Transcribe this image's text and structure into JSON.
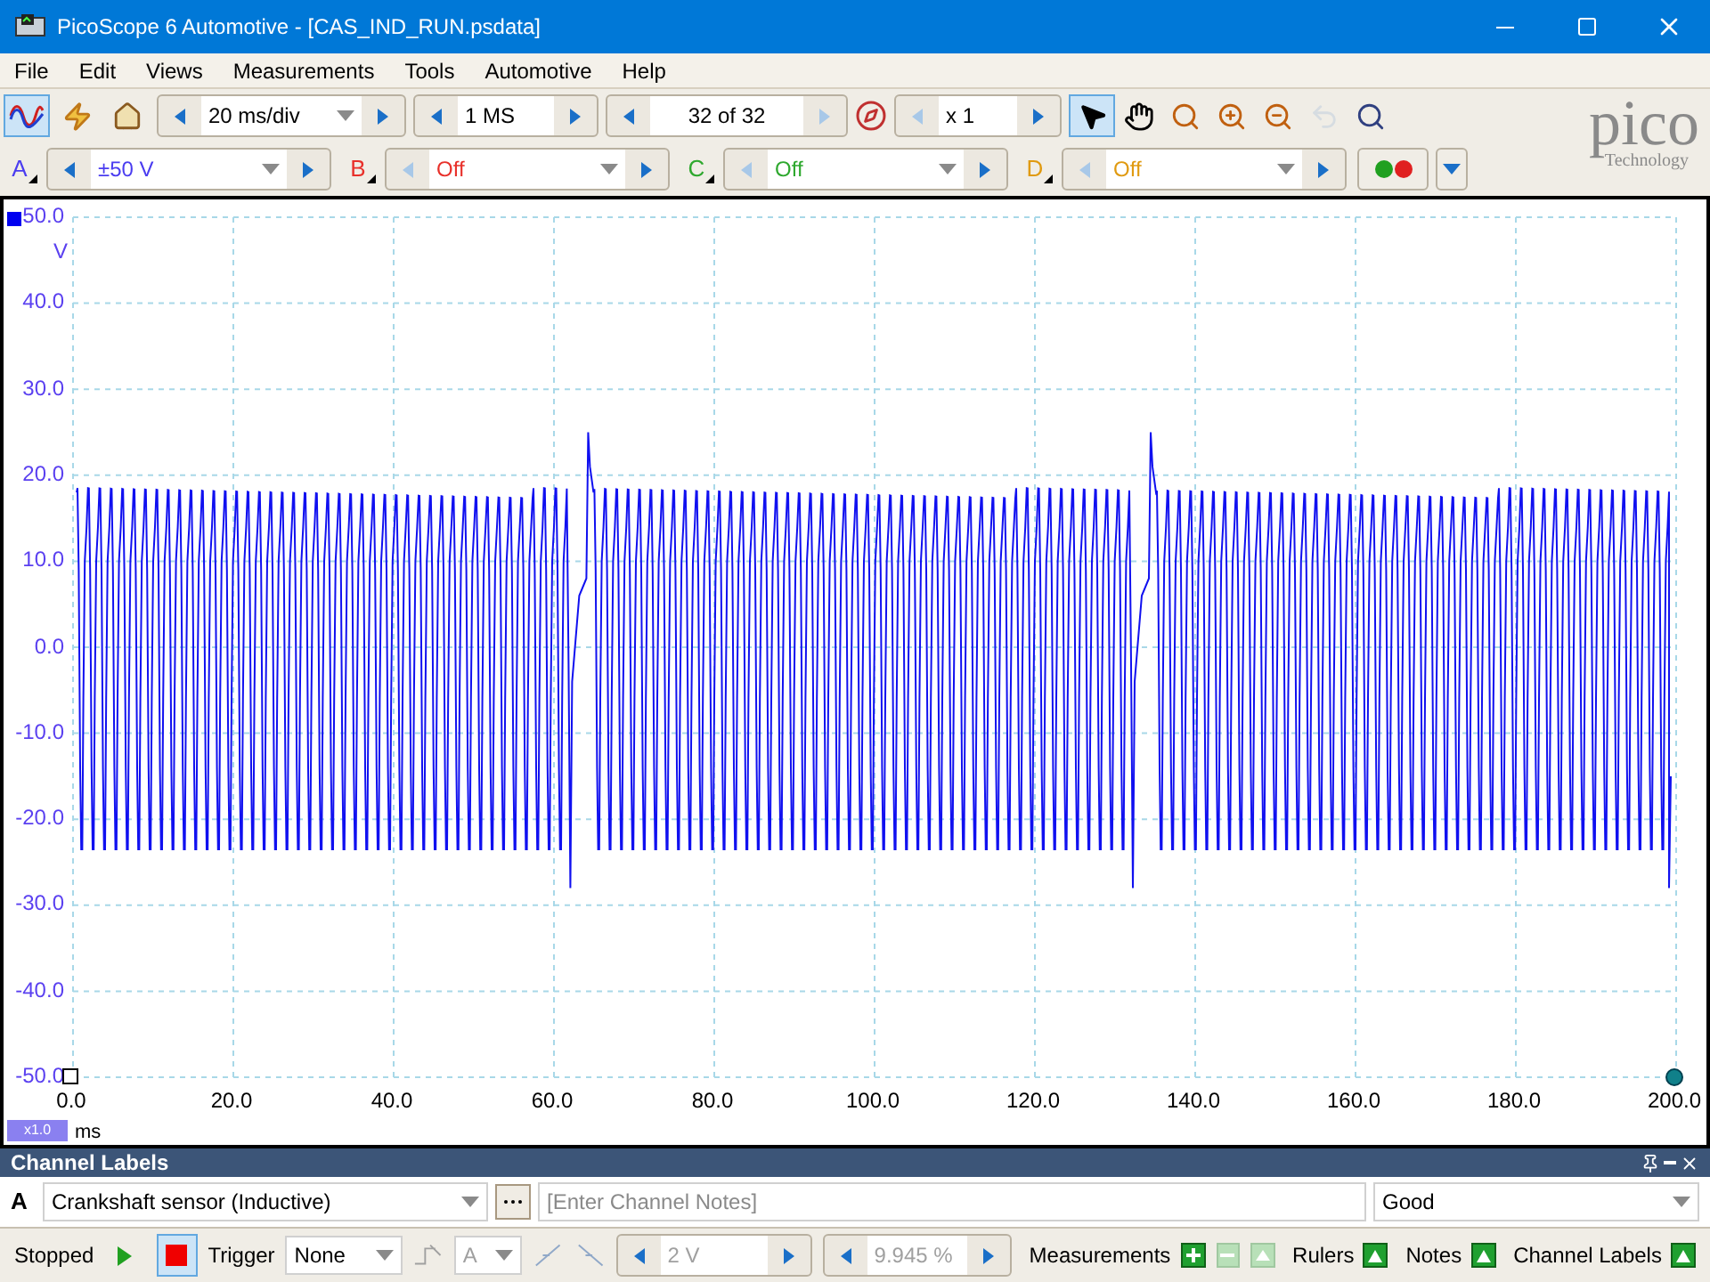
{
  "window": {
    "title": "PicoScope 6 Automotive - [CAS_IND_RUN.psdata]"
  },
  "menu": [
    "File",
    "Edit",
    "Views",
    "Measurements",
    "Tools",
    "Automotive",
    "Help"
  ],
  "toolbar": {
    "mode_tools": [
      {
        "kind": "scope",
        "selected": true
      },
      {
        "kind": "auto",
        "selected": false
      },
      {
        "kind": "home",
        "selected": false
      }
    ],
    "timebase": {
      "value": "20 ms/div",
      "prev_disabled": false,
      "next_disabled": false
    },
    "samples": {
      "value": "1 MS",
      "prev_disabled": false,
      "next_disabled": false
    },
    "buffer": {
      "value": "32 of 32",
      "prev_disabled": false,
      "next_disabled": true
    },
    "zoom": {
      "value": "x 1",
      "prev_disabled": true,
      "next_disabled": false
    },
    "view_tools": [
      {
        "kind": "pointer",
        "selected": true,
        "disabled": false
      },
      {
        "kind": "hand",
        "selected": false,
        "disabled": false
      },
      {
        "kind": "zoom",
        "selected": false,
        "disabled": false
      },
      {
        "kind": "zoom_in",
        "selected": false,
        "disabled": false
      },
      {
        "kind": "zoom_out",
        "selected": false,
        "disabled": false
      },
      {
        "kind": "undo",
        "selected": false,
        "disabled": true
      },
      {
        "kind": "zoom_fit",
        "selected": false,
        "disabled": false
      }
    ]
  },
  "logo": {
    "name": "pico",
    "tagline": "Technology"
  },
  "channels": [
    {
      "letter": "A",
      "range": "±50 V",
      "color": "#4a3cf0",
      "prev_disabled": false
    },
    {
      "letter": "B",
      "range": "Off",
      "color": "#e8302a",
      "prev_disabled": true
    },
    {
      "letter": "C",
      "range": "Off",
      "color": "#2ea82e",
      "prev_disabled": true
    },
    {
      "letter": "D",
      "range": "Off",
      "color": "#e09a10",
      "prev_disabled": true
    }
  ],
  "scope": {
    "y_unit": "V",
    "y_ticks": [
      "50.0",
      "40.0",
      "30.0",
      "20.0",
      "10.0",
      "0.0",
      "-10.0",
      "-20.0",
      "-30.0",
      "-40.0",
      "-50.0"
    ],
    "x_ticks": [
      "0.0",
      "20.0",
      "40.0",
      "60.0",
      "80.0",
      "100.0",
      "120.0",
      "140.0",
      "160.0",
      "180.0",
      "200.0"
    ],
    "x_unit": "ms",
    "x_zoom": "x1.0"
  },
  "channel_labels": {
    "title": "Channel Labels",
    "channel": "A",
    "label": "Crankshaft sensor (Inductive)",
    "notes_placeholder": "[Enter Channel Notes]",
    "quality": "Good"
  },
  "status_bar": {
    "state": "Stopped",
    "run_buttons": [
      {
        "kind": "start",
        "selected": false
      },
      {
        "kind": "stop",
        "selected": true
      }
    ],
    "trigger_label": "Trigger",
    "trigger_mode": "None",
    "trigger_channel": {
      "value": "A",
      "disabled": true
    },
    "threshold": {
      "value": "2 V",
      "disabled": true
    },
    "pretrigger": {
      "value": "9.945 %",
      "disabled": true
    },
    "measurements": "Measurements",
    "measurement_buttons": [
      {
        "kind": "add",
        "disabled": false
      },
      {
        "kind": "remove",
        "disabled": true
      },
      {
        "kind": "edit",
        "disabled": true
      }
    ],
    "toggles": [
      {
        "label": "Rulers"
      },
      {
        "label": "Notes"
      },
      {
        "label": "Channel Labels"
      }
    ]
  }
}
